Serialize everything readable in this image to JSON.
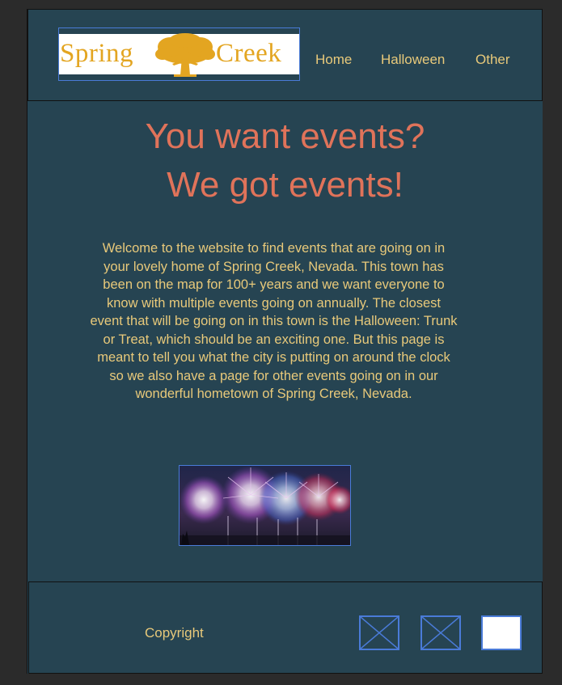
{
  "header": {
    "logo": {
      "left_text": "Spring",
      "right_text": "Creek",
      "icon": "oak-tree-icon",
      "gold_color": "#e3a521"
    },
    "nav": [
      {
        "label": "Home"
      },
      {
        "label": "Halloween"
      },
      {
        "label": "Other"
      }
    ]
  },
  "main": {
    "headline_line1": "You want events?",
    "headline_line2": "We got events!",
    "intro": "Welcome to the website to find events that are going on in your lovely home of Spring Creek, Nevada. This town has been on the map for 100+ years and we want everyone to know with multiple events going on annually. The closest event that will be going on in this town is the Halloween: Trunk or Treat, which should be an exciting one. But this page is meant to tell you what the city is putting on around the clock so we also have a page for other events going on in our wonderful hometown of Spring Creek, Nevada.",
    "image": "fireworks-image"
  },
  "footer": {
    "copyright": "Copyright",
    "social": [
      {
        "icon": "placeholder-x-icon"
      },
      {
        "icon": "placeholder-x-icon"
      },
      {
        "icon": "blank-placeholder"
      }
    ]
  },
  "colors": {
    "background": "#264452",
    "accent_gold": "#e8c97a",
    "headline": "#e0735a",
    "selection_blue": "#4a7bd8"
  }
}
